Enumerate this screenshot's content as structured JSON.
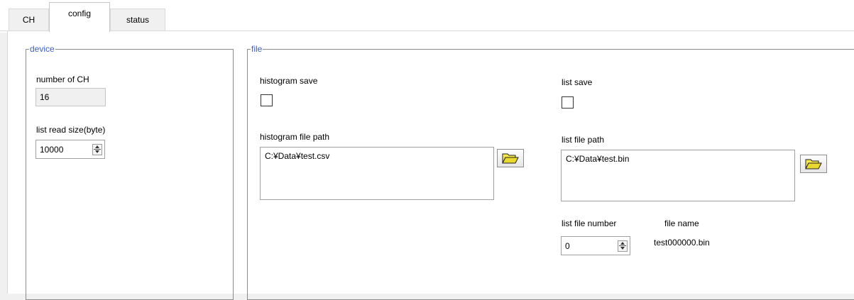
{
  "tabs": [
    {
      "label": "CH",
      "active": false
    },
    {
      "label": "config",
      "active": true
    },
    {
      "label": "status",
      "active": false
    }
  ],
  "device": {
    "legend": "device",
    "num_ch_label": "number of CH",
    "num_ch_value": "16",
    "read_size_label": "list read size(byte)",
    "read_size_value": "10000"
  },
  "file": {
    "legend": "file",
    "histogram_save_label": "histogram save",
    "histogram_save_checked": false,
    "list_save_label": "list save",
    "list_save_checked": false,
    "histogram_path_label": "histogram file path",
    "histogram_path_value": "C:¥Data¥test.csv",
    "list_path_label": "list file path",
    "list_path_value": "C:¥Data¥test.bin",
    "list_number_label": "list file number",
    "list_number_value": "0",
    "file_name_label": "file name",
    "file_name_value": "test000000.bin"
  },
  "icons": {
    "spinner": "up-down-spinner-icon",
    "browse": "folder-open-icon"
  },
  "colors": {
    "legend": "#3a5fcd",
    "folder": "#f5e84a"
  }
}
